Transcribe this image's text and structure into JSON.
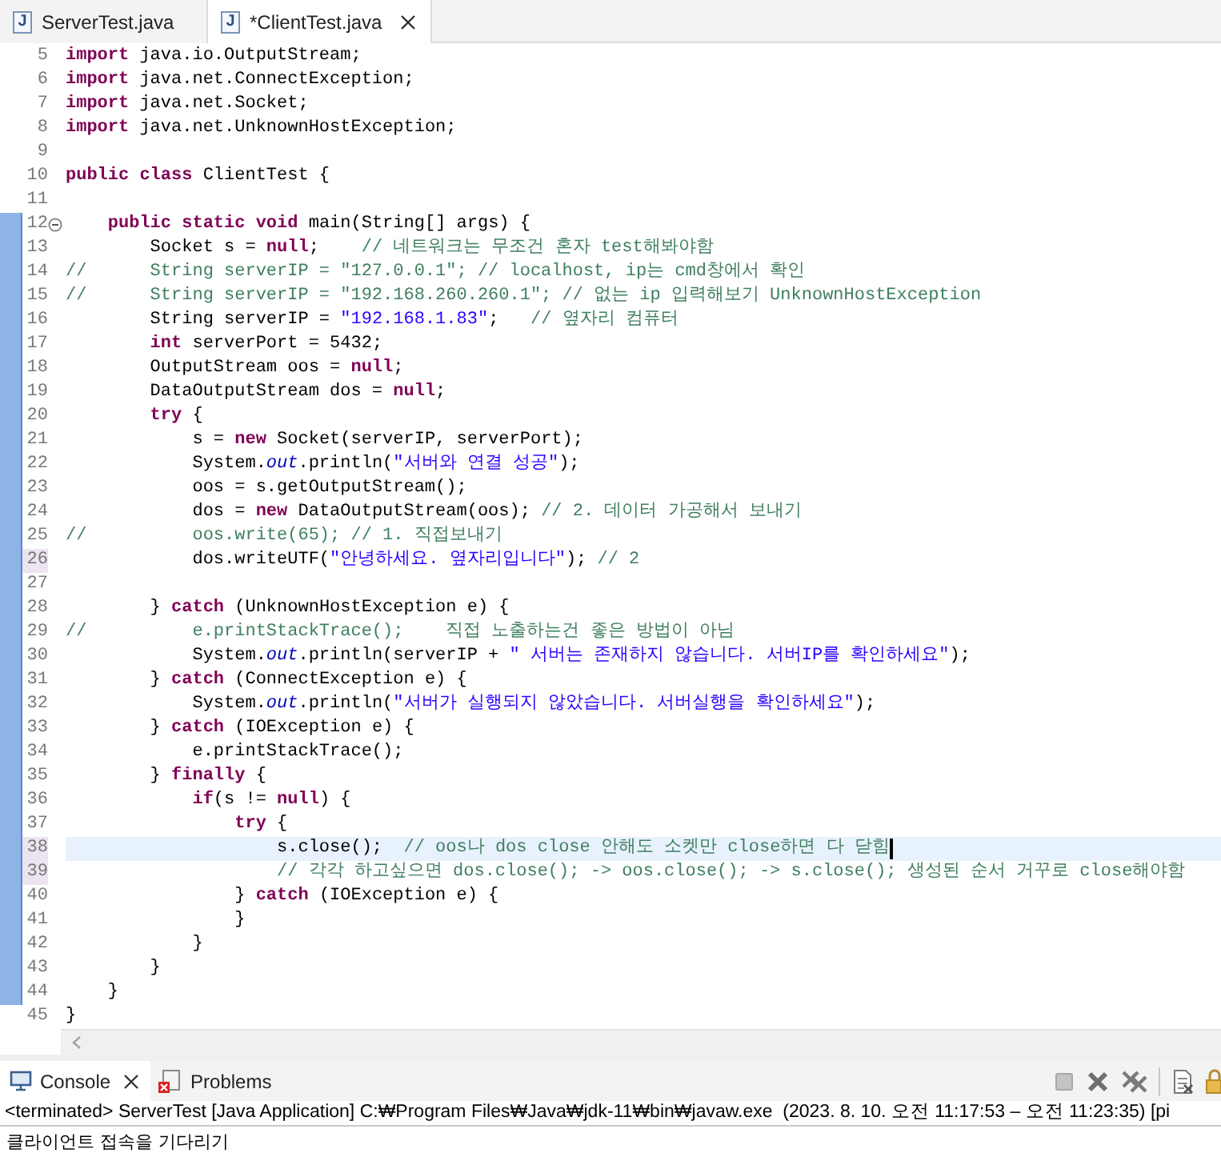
{
  "editor_tabs": [
    {
      "icon_text": "J",
      "label": "ServerTest.java",
      "selected": false,
      "closable": false
    },
    {
      "icon_text": "J",
      "label": "*ClientTest.java",
      "selected": true,
      "closable": true
    }
  ],
  "lines": [
    {
      "number": "5",
      "added": false,
      "changed": false,
      "foldable": false,
      "current": false,
      "tokens": [
        {
          "kind": "keyword",
          "text": "import"
        },
        {
          "kind": "plain",
          "text": " java.io.OutputStream;"
        }
      ]
    },
    {
      "number": "6",
      "added": false,
      "changed": false,
      "foldable": false,
      "current": false,
      "tokens": [
        {
          "kind": "keyword",
          "text": "import"
        },
        {
          "kind": "plain",
          "text": " java.net.ConnectException;"
        }
      ]
    },
    {
      "number": "7",
      "added": false,
      "changed": false,
      "foldable": false,
      "current": false,
      "tokens": [
        {
          "kind": "keyword",
          "text": "import"
        },
        {
          "kind": "plain",
          "text": " java.net.Socket;"
        }
      ]
    },
    {
      "number": "8",
      "added": false,
      "changed": false,
      "foldable": false,
      "current": false,
      "tokens": [
        {
          "kind": "keyword",
          "text": "import"
        },
        {
          "kind": "plain",
          "text": " java.net.UnknownHostException;"
        }
      ]
    },
    {
      "number": "9",
      "added": false,
      "changed": false,
      "foldable": false,
      "current": false
    },
    {
      "number": "10",
      "added": false,
      "changed": false,
      "foldable": false,
      "current": false,
      "tokens": [
        {
          "kind": "keyword",
          "text": "public"
        },
        {
          "kind": "keyword",
          "text": " class"
        },
        {
          "kind": "plain",
          "text": " ClientTest {"
        }
      ]
    },
    {
      "number": "11",
      "added": false,
      "changed": false,
      "foldable": false,
      "current": false
    },
    {
      "number": "12",
      "added": true,
      "changed": false,
      "foldable": true,
      "current": false,
      "tokens": [
        {
          "kind": "keyword",
          "text": "    public"
        },
        {
          "kind": "keyword",
          "text": " static"
        },
        {
          "kind": "keyword",
          "text": " void"
        },
        {
          "kind": "plain",
          "text": " main(String[] args) {"
        }
      ]
    },
    {
      "number": "13",
      "added": true,
      "changed": false,
      "foldable": false,
      "current": false,
      "tokens": [
        {
          "kind": "plain",
          "text": "        Socket s = "
        },
        {
          "kind": "keyword",
          "text": "null"
        },
        {
          "kind": "plain",
          "text": ";"
        },
        {
          "kind": "comment",
          "text": "    // 네트워크는 무조건 혼자 test해봐야함"
        }
      ]
    },
    {
      "number": "14",
      "added": true,
      "changed": false,
      "foldable": false,
      "current": false,
      "tokens": [
        {
          "kind": "comment",
          "text": "//      String serverIP = \"127.0.0.1\"; // localhost, ip는 cmd창에서 확인"
        }
      ]
    },
    {
      "number": "15",
      "added": true,
      "changed": false,
      "foldable": false,
      "current": false,
      "tokens": [
        {
          "kind": "comment",
          "text": "//      String serverIP = \"192.168.260.260.1\"; // 없는 ip 입력해보기 UnknownHostException"
        }
      ]
    },
    {
      "number": "16",
      "added": true,
      "changed": false,
      "foldable": false,
      "current": false,
      "tokens": [
        {
          "kind": "plain",
          "text": "        String serverIP = "
        },
        {
          "kind": "string",
          "text": "\"192.168.1.83\""
        },
        {
          "kind": "plain",
          "text": ";"
        },
        {
          "kind": "comment",
          "text": "   // 옆자리 컴퓨터"
        }
      ]
    },
    {
      "number": "17",
      "added": true,
      "changed": false,
      "foldable": false,
      "current": false,
      "tokens": [
        {
          "kind": "keyword",
          "text": "        int"
        },
        {
          "kind": "plain",
          "text": " serverPort = 5432;"
        }
      ]
    },
    {
      "number": "18",
      "added": true,
      "changed": false,
      "foldable": false,
      "current": false,
      "tokens": [
        {
          "kind": "plain",
          "text": "        OutputStream oos = "
        },
        {
          "kind": "keyword",
          "text": "null"
        },
        {
          "kind": "plain",
          "text": ";"
        }
      ]
    },
    {
      "number": "19",
      "added": true,
      "changed": false,
      "foldable": false,
      "current": false,
      "tokens": [
        {
          "kind": "plain",
          "text": "        DataOutputStream dos = "
        },
        {
          "kind": "keyword",
          "text": "null"
        },
        {
          "kind": "plain",
          "text": ";"
        }
      ]
    },
    {
      "number": "20",
      "added": true,
      "changed": false,
      "foldable": false,
      "current": false,
      "tokens": [
        {
          "kind": "keyword",
          "text": "        try"
        },
        {
          "kind": "plain",
          "text": " {"
        }
      ]
    },
    {
      "number": "21",
      "added": true,
      "changed": false,
      "foldable": false,
      "current": false,
      "tokens": [
        {
          "kind": "plain",
          "text": "            s = "
        },
        {
          "kind": "keyword",
          "text": "new"
        },
        {
          "kind": "plain",
          "text": " Socket(serverIP, serverPort);"
        }
      ]
    },
    {
      "number": "22",
      "added": true,
      "changed": false,
      "foldable": false,
      "current": false,
      "tokens": [
        {
          "kind": "plain",
          "text": "            System."
        },
        {
          "kind": "field",
          "text": "out"
        },
        {
          "kind": "plain",
          "text": ".println("
        },
        {
          "kind": "string",
          "text": "\"서버와 연결 성공\""
        },
        {
          "kind": "plain",
          "text": ");"
        }
      ]
    },
    {
      "number": "23",
      "added": true,
      "changed": false,
      "foldable": false,
      "current": false,
      "tokens": [
        {
          "kind": "plain",
          "text": "            oos = s.getOutputStream();"
        }
      ]
    },
    {
      "number": "24",
      "added": true,
      "changed": false,
      "foldable": false,
      "current": false,
      "tokens": [
        {
          "kind": "plain",
          "text": "            dos = "
        },
        {
          "kind": "keyword",
          "text": "new"
        },
        {
          "kind": "plain",
          "text": " DataOutputStream(oos); "
        },
        {
          "kind": "comment",
          "text": "// 2. 데이터 가공해서 보내기"
        }
      ]
    },
    {
      "number": "25",
      "added": true,
      "changed": false,
      "foldable": false,
      "current": false,
      "tokens": [
        {
          "kind": "comment",
          "text": "//          oos.write(65); // 1. 직접보내기"
        }
      ]
    },
    {
      "number": "26",
      "added": true,
      "changed": true,
      "foldable": false,
      "current": false,
      "tokens": [
        {
          "kind": "plain",
          "text": "            dos.writeUTF("
        },
        {
          "kind": "string",
          "text": "\"안녕하세요. 옆자리입니다\""
        },
        {
          "kind": "plain",
          "text": "); "
        },
        {
          "kind": "comment",
          "text": "// 2"
        }
      ]
    },
    {
      "number": "27",
      "added": true,
      "changed": false,
      "foldable": false,
      "current": false
    },
    {
      "number": "28",
      "added": true,
      "changed": false,
      "foldable": false,
      "current": false,
      "tokens": [
        {
          "kind": "plain",
          "text": "        } "
        },
        {
          "kind": "keyword",
          "text": "catch"
        },
        {
          "kind": "plain",
          "text": " (UnknownHostException e) {"
        }
      ]
    },
    {
      "number": "29",
      "added": true,
      "changed": false,
      "foldable": false,
      "current": false,
      "tokens": [
        {
          "kind": "comment",
          "text": "//          e.printStackTrace();    직접 노출하는건 좋은 방법이 아님"
        }
      ]
    },
    {
      "number": "30",
      "added": true,
      "changed": false,
      "foldable": false,
      "current": false,
      "tokens": [
        {
          "kind": "plain",
          "text": "            System."
        },
        {
          "kind": "field",
          "text": "out"
        },
        {
          "kind": "plain",
          "text": ".println(serverIP + "
        },
        {
          "kind": "string",
          "text": "\" 서버는 존재하지 않습니다. 서버IP를 확인하세요\""
        },
        {
          "kind": "plain",
          "text": ");"
        }
      ]
    },
    {
      "number": "31",
      "added": true,
      "changed": false,
      "foldable": false,
      "current": false,
      "tokens": [
        {
          "kind": "plain",
          "text": "        } "
        },
        {
          "kind": "keyword",
          "text": "catch"
        },
        {
          "kind": "plain",
          "text": " (ConnectException e) {"
        }
      ]
    },
    {
      "number": "32",
      "added": true,
      "changed": false,
      "foldable": false,
      "current": false,
      "tokens": [
        {
          "kind": "plain",
          "text": "            System."
        },
        {
          "kind": "field",
          "text": "out"
        },
        {
          "kind": "plain",
          "text": ".println("
        },
        {
          "kind": "string",
          "text": "\"서버가 실행되지 않았습니다. 서버실행을 확인하세요\""
        },
        {
          "kind": "plain",
          "text": ");"
        }
      ]
    },
    {
      "number": "33",
      "added": true,
      "changed": false,
      "foldable": false,
      "current": false,
      "tokens": [
        {
          "kind": "plain",
          "text": "        } "
        },
        {
          "kind": "keyword",
          "text": "catch"
        },
        {
          "kind": "plain",
          "text": " (IOException e) {"
        }
      ]
    },
    {
      "number": "34",
      "added": true,
      "changed": false,
      "foldable": false,
      "current": false,
      "tokens": [
        {
          "kind": "plain",
          "text": "            e.printStackTrace();"
        }
      ]
    },
    {
      "number": "35",
      "added": true,
      "changed": false,
      "foldable": false,
      "current": false,
      "tokens": [
        {
          "kind": "plain",
          "text": "        } "
        },
        {
          "kind": "keyword",
          "text": "finally"
        },
        {
          "kind": "plain",
          "text": " {"
        }
      ]
    },
    {
      "number": "36",
      "added": true,
      "changed": false,
      "foldable": false,
      "current": false,
      "tokens": [
        {
          "kind": "keyword",
          "text": "            if"
        },
        {
          "kind": "plain",
          "text": "(s != "
        },
        {
          "kind": "keyword",
          "text": "null"
        },
        {
          "kind": "plain",
          "text": ") {"
        }
      ]
    },
    {
      "number": "37",
      "added": true,
      "changed": false,
      "foldable": false,
      "current": false,
      "tokens": [
        {
          "kind": "keyword",
          "text": "                try"
        },
        {
          "kind": "plain",
          "text": " {"
        }
      ]
    },
    {
      "number": "38",
      "added": true,
      "changed": true,
      "foldable": false,
      "current": true,
      "tokens": [
        {
          "kind": "plain",
          "text": "                    s.close();"
        },
        {
          "kind": "comment",
          "text": "  // oos나 dos close 안해도 소켓만 close하면 다 닫힘"
        }
      ]
    },
    {
      "number": "39",
      "added": true,
      "changed": true,
      "foldable": false,
      "current": false,
      "tokens": [
        {
          "kind": "comment",
          "text": "                    // 각각 하고싶으면 dos.close(); -> oos.close(); -> s.close(); 생성된 순서 거꾸로 close해야함"
        }
      ]
    },
    {
      "number": "40",
      "added": true,
      "changed": false,
      "foldable": false,
      "current": false,
      "tokens": [
        {
          "kind": "plain",
          "text": "                } "
        },
        {
          "kind": "keyword",
          "text": "catch"
        },
        {
          "kind": "plain",
          "text": " (IOException e) {"
        }
      ]
    },
    {
      "number": "41",
      "added": true,
      "changed": false,
      "foldable": false,
      "current": false,
      "tokens": [
        {
          "kind": "plain",
          "text": "                }"
        }
      ]
    },
    {
      "number": "42",
      "added": true,
      "changed": false,
      "foldable": false,
      "current": false,
      "tokens": [
        {
          "kind": "plain",
          "text": "            }"
        }
      ]
    },
    {
      "number": "43",
      "added": true,
      "changed": false,
      "foldable": false,
      "current": false,
      "tokens": [
        {
          "kind": "plain",
          "text": "        }"
        }
      ]
    },
    {
      "number": "44",
      "added": true,
      "changed": false,
      "foldable": false,
      "current": false,
      "tokens": [
        {
          "kind": "plain",
          "text": "    }"
        }
      ]
    },
    {
      "number": "45",
      "added": false,
      "changed": false,
      "foldable": false,
      "current": false,
      "tokens": [
        {
          "kind": "plain",
          "text": "}"
        }
      ]
    }
  ],
  "console_tabs": [
    {
      "label": "Console",
      "selected": true,
      "closable": true
    },
    {
      "label": "Problems",
      "selected": false,
      "closable": false
    }
  ],
  "console": {
    "status": "<terminated> ServerTest [Java Application] C:₩Program Files₩Java₩jdk-11₩bin₩javaw.exe  (2023. 8. 10. 오전 11:17:53 – 오전 11:23:35) [pi",
    "output": "클라이언트 접속을 기다리기"
  }
}
